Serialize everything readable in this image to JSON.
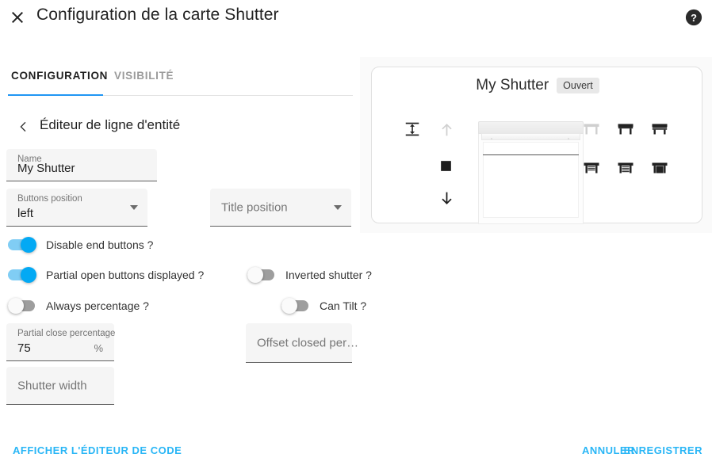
{
  "header": {
    "title": "Configuration de la carte Shutter",
    "close_icon": "close-icon",
    "help_icon": "help-icon"
  },
  "tabs": [
    {
      "label": "CONFIGURATION",
      "active": true
    },
    {
      "label": "VISIBILITÉ",
      "active": false
    }
  ],
  "subheader": {
    "back_icon": "chevron-left-icon",
    "title": "Éditeur de ligne d'entité"
  },
  "fields": {
    "name": {
      "label": "Name",
      "value": "My Shutter"
    },
    "buttons_position": {
      "label": "Buttons position",
      "value": "left"
    },
    "title_position": {
      "placeholder": "Title position"
    },
    "partial_close_percentage": {
      "label": "Partial close percentage",
      "value": "75",
      "suffix": "%"
    },
    "offset_closed_percentage": {
      "placeholder": "Offset closed per…"
    },
    "shutter_width": {
      "placeholder": "Shutter width"
    }
  },
  "toggles": [
    {
      "key": "disable_end_buttons",
      "label": "Disable end buttons ?",
      "on": true
    },
    {
      "key": "partial_open_buttons",
      "label": "Partial open buttons displayed ?",
      "on": true
    },
    {
      "key": "always_percentage",
      "label": "Always percentage ?",
      "on": false
    },
    {
      "key": "inverted_shutter",
      "label": "Inverted shutter ?",
      "on": false
    },
    {
      "key": "can_tilt",
      "label": "Can Tilt ?",
      "on": false
    }
  ],
  "preview": {
    "name": "My Shutter",
    "status": "Ouvert",
    "controls": [
      {
        "name": "resize-height-icon",
        "state": "enabled"
      },
      {
        "name": "arrow-up-icon",
        "state": "disabled"
      },
      {
        "name": "stop-square-icon",
        "state": "enabled"
      },
      {
        "name": "arrow-down-icon",
        "state": "enabled"
      }
    ],
    "shutter_buttons": [
      {
        "name": "shutter-open-full-icon",
        "state": "disabled"
      },
      {
        "name": "shutter-open-25-icon",
        "state": "enabled"
      },
      {
        "name": "shutter-open-50-icon",
        "state": "enabled"
      },
      {
        "name": "shutter-open-75-icon",
        "state": "enabled"
      },
      {
        "name": "shutter-closed-slats-icon",
        "state": "enabled"
      },
      {
        "name": "shutter-closed-full-icon",
        "state": "enabled"
      }
    ]
  },
  "footer": {
    "show_code_editor": "AFFICHER L'ÉDITEUR DE CODE",
    "cancel": "ANNULER",
    "save": "ENREGISTRER"
  },
  "colors": {
    "accent": "#2196f3",
    "footer_link": "#29b6f6",
    "toggle_on_knob": "#03a9f4",
    "toggle_on_track": "#80cdf4",
    "toggle_off_track": "#9e9e9e"
  }
}
